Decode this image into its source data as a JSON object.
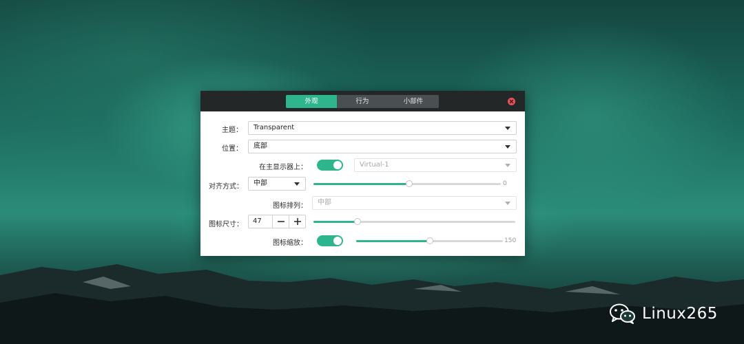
{
  "dialog": {
    "tabs": [
      {
        "label": "外观",
        "active": true
      },
      {
        "label": "行为",
        "active": false
      },
      {
        "label": "小部件",
        "active": false
      }
    ],
    "theme": {
      "label": "主题：",
      "value": "Transparent"
    },
    "position": {
      "label": "位置：",
      "value": "底部"
    },
    "primary_display": {
      "label": "在主显示器上：",
      "toggle_on": true,
      "value": "Virtual-1"
    },
    "alignment": {
      "label": "对齐方式：",
      "value": "中部",
      "slider_fraction": 0.51,
      "slider_value": "0"
    },
    "icon_arrangement": {
      "label": "图标排列：",
      "value": "中部"
    },
    "icon_size": {
      "label": "图标尺寸：",
      "value": "47",
      "minus": "−",
      "plus": "+",
      "slider_fraction": 0.22
    },
    "icon_zoom": {
      "label": "图标缩放：",
      "toggle_on": true,
      "slider_fraction": 0.5,
      "slider_value": "150"
    }
  },
  "watermark": {
    "text": "Linux265",
    "icon": "wechat-icon"
  },
  "colors": {
    "accent": "#2fb58d",
    "titlebar": "#232728",
    "close": "#e5545b"
  }
}
